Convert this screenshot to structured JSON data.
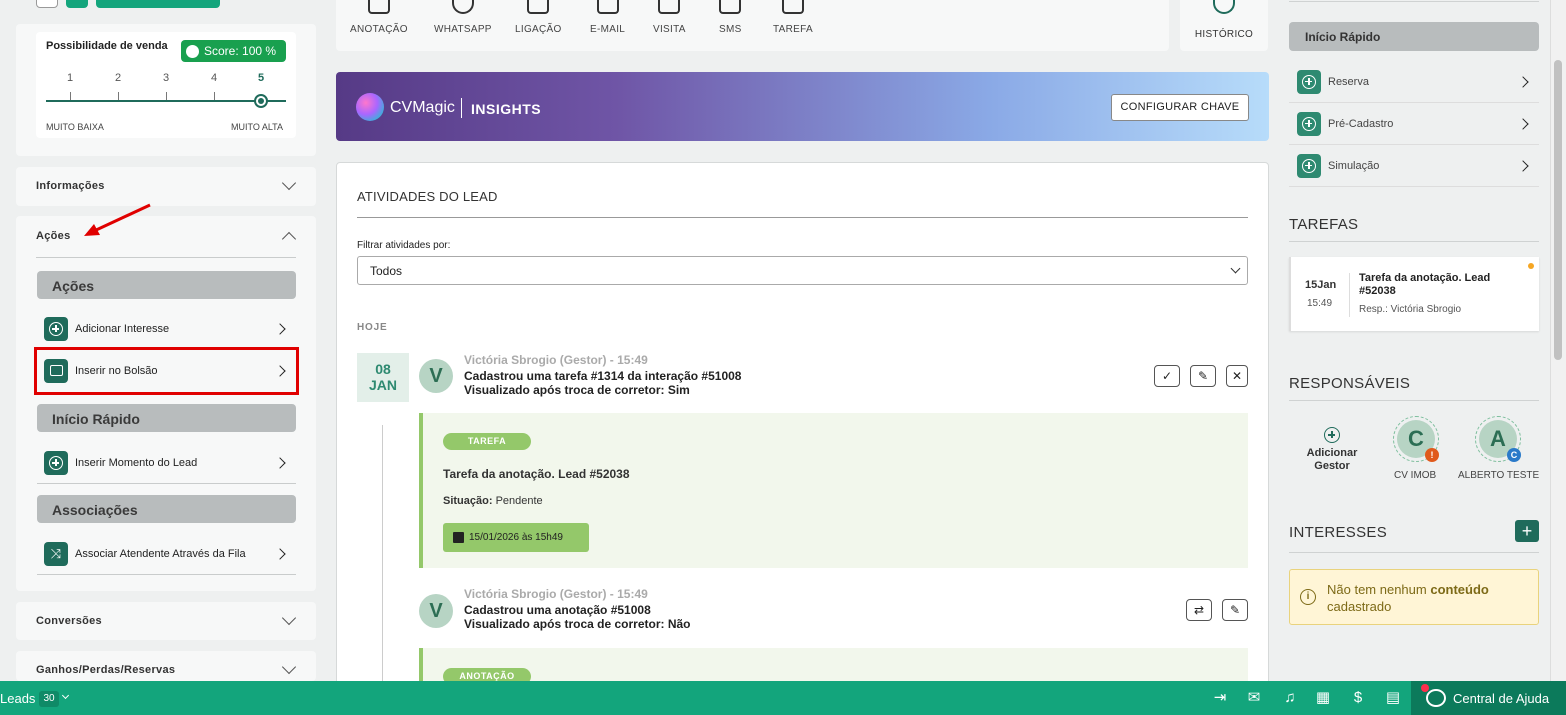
{
  "sale_possibility": {
    "title": "Possibilidade de venda",
    "score_label": "Score: 100 %",
    "scale": [
      "1",
      "2",
      "3",
      "4",
      "5"
    ],
    "low_label": "MUITO BAIXA",
    "high_label": "MUITO ALTA",
    "level": 5
  },
  "left": {
    "info_label": "Informações",
    "acoes_label": "Ações",
    "group_acoes": "Ações",
    "add_interest": "Adicionar Interesse",
    "insert_pocket": "Inserir no Bolsão",
    "group_quick": "Início Rápido",
    "insert_moment": "Inserir Momento do Lead",
    "group_assoc": "Associações",
    "assoc_attendant": "Associar Atendente Através da Fila",
    "conversions": "Conversões",
    "gains": "Ganhos/Perdas/Reservas"
  },
  "toolbar": {
    "items": [
      "ANOTAÇÃO",
      "WHATSAPP",
      "LIGAÇÃO",
      "E-MAIL",
      "VISITA",
      "SMS",
      "TAREFA"
    ],
    "history": "HISTÓRICO"
  },
  "cvmagic": {
    "brand": "CVMagic",
    "insights": "INSIGHTS",
    "configure": "CONFIGURAR CHAVE"
  },
  "activities": {
    "title": "ATIVIDADES DO LEAD",
    "filter_label": "Filtrar atividades por:",
    "filter_value": "Todos",
    "today": "HOJE",
    "date_day": "08",
    "date_month": "JAN",
    "item1": {
      "author": "Victória Sbrogio (Gestor) - 15:49",
      "line1": "Cadastrou uma tarefa #1314 da interação #51008",
      "line2": "Visualizado após troca de corretor:  Sim",
      "tag": "TAREFA",
      "task_title": "Tarefa da anotação. Lead #52038",
      "status_label": "Situação:",
      "status_value": "Pendente",
      "due": "15/01/2026 às 15h49"
    },
    "item2": {
      "author": "Victória Sbrogio (Gestor) - 15:49",
      "line1": "Cadastrou uma anotação #51008",
      "line2": "Visualizado após troca de corretor:  Não",
      "tag": "ANOTAÇÃO"
    },
    "avatar_letter": "V"
  },
  "right": {
    "quick_start": "Início Rápido",
    "reserva": "Reserva",
    "pre_cadastro": "Pré-Cadastro",
    "simulacao": "Simulação",
    "tasks_title": "TAREFAS",
    "task_day": "15Jan",
    "task_time": "15:49",
    "task_text": "Tarefa da anotação. Lead #52038",
    "task_resp": "Resp.: Victória Sbrogio",
    "resp_title": "RESPONSÁVEIS",
    "add_manager": "Adicionar Gestor",
    "resp1_letter": "C",
    "resp1_name": "CV IMOB",
    "resp2_letter": "A",
    "resp2_name": "ALBERTO TESTE",
    "interests_title": "INTERESSES",
    "no_interest_a": "Não tem nenhum ",
    "no_interest_b": "conteúdo",
    "no_interest_c": "cadastrado"
  },
  "bottombar": {
    "leads": "Leads",
    "count": "30",
    "help": "Central de Ajuda"
  },
  "colors": {
    "green": "#13a57c",
    "dark_green": "#1f6b5b",
    "purple": "#5b3d8f",
    "highlight": "#e00000"
  }
}
